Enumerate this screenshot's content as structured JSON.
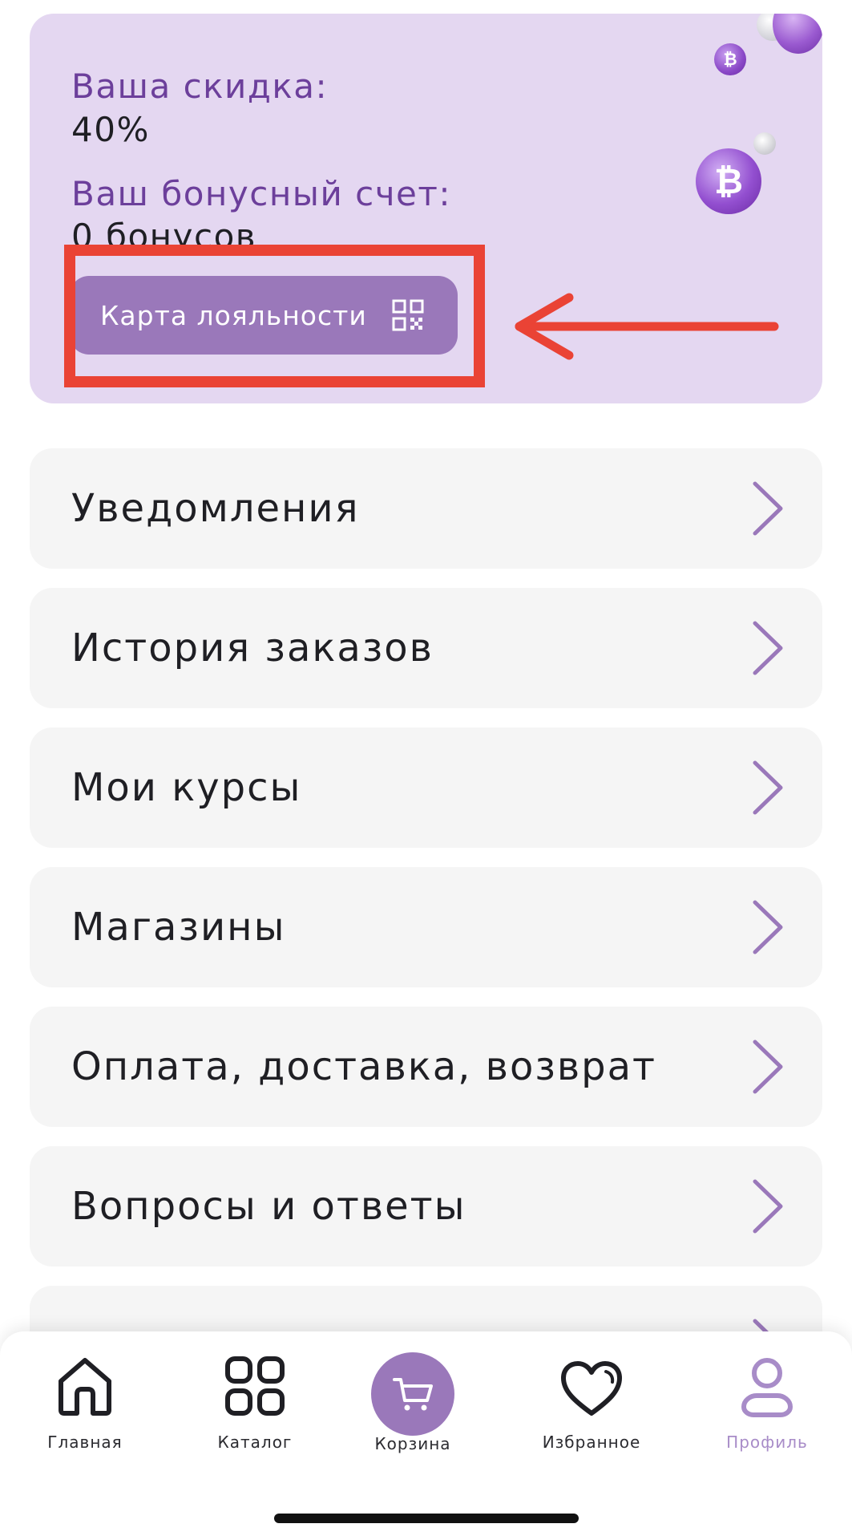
{
  "loyalty": {
    "discount_label": "Ваша скидка:",
    "discount_value": "40%",
    "bonus_label": "Ваш бонусный счет:",
    "bonus_value": "0 бонусов",
    "card_button_label": "Карта лояльности",
    "card_button_icon": "qr-code-icon",
    "coin_symbol": "₿"
  },
  "menu": {
    "items": [
      {
        "label": "Уведомления"
      },
      {
        "label": "История заказов"
      },
      {
        "label": "Мои курсы"
      },
      {
        "label": "Магазины"
      },
      {
        "label": "Оплата, доставка, возврат"
      },
      {
        "label": "Вопросы и ответы"
      }
    ]
  },
  "tabbar": {
    "home": "Главная",
    "catalog": "Каталог",
    "cart": "Корзина",
    "favorites": "Избранное",
    "profile": "Профиль",
    "active": "profile"
  },
  "colors": {
    "accent": "#9a78ba",
    "card_bg": "#e4d7f1",
    "label_purple": "#6c3f9b",
    "annotation_red": "#ea4335"
  }
}
